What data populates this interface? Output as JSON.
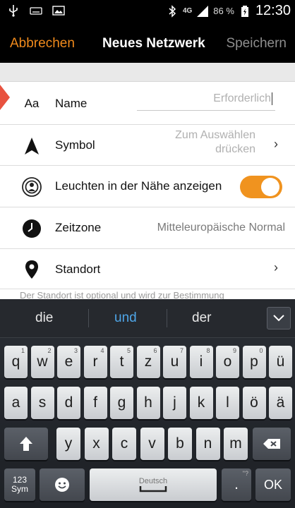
{
  "status_bar": {
    "network": "4G",
    "battery_percent": "86 %",
    "time": "12:30",
    "icons": [
      "usb-icon",
      "keyboard-status-icon",
      "image-icon",
      "bluetooth-icon",
      "signal-icon",
      "battery-icon"
    ]
  },
  "action_bar": {
    "cancel_label": "Abbrechen",
    "title": "Neues Netzwerk",
    "save_label": "Speichern",
    "accent_color": "#f08a1c"
  },
  "form": {
    "name": {
      "icon_text": "Aa",
      "label": "Name",
      "placeholder": "Erforderlich"
    },
    "symbol": {
      "label": "Symbol",
      "value_line1": "Zum Auswählen",
      "value_line2": "drücken"
    },
    "nearby": {
      "label": "Leuchten in der Nähe anzeigen",
      "toggle_on": true
    },
    "timezone": {
      "label": "Zeitzone",
      "value": "Mitteleuropäische Normal"
    },
    "location": {
      "label": "Standort"
    },
    "footnote": "Der Standort ist optional und wird zur Bestimmung"
  },
  "keyboard": {
    "suggestions": [
      "die",
      "und",
      "der"
    ],
    "row1": [
      {
        "key": "q",
        "num": "1"
      },
      {
        "key": "w",
        "num": "2"
      },
      {
        "key": "e",
        "num": "3"
      },
      {
        "key": "r",
        "num": "4"
      },
      {
        "key": "t",
        "num": "5"
      },
      {
        "key": "z",
        "num": "6"
      },
      {
        "key": "u",
        "num": "7"
      },
      {
        "key": "i",
        "num": "8"
      },
      {
        "key": "o",
        "num": "9"
      },
      {
        "key": "p",
        "num": "0"
      },
      {
        "key": "ü",
        "num": ""
      }
    ],
    "row2": [
      "a",
      "s",
      "d",
      "f",
      "g",
      "h",
      "j",
      "k",
      "l",
      "ö",
      "ä"
    ],
    "row3": [
      "y",
      "x",
      "c",
      "v",
      "b",
      "n",
      "m"
    ],
    "sym_label_1": "123",
    "sym_label_2": "Sym",
    "space_label": "Deutsch",
    "period_label": ".",
    "period_hint": "\"?",
    "ok_label": "OK"
  }
}
